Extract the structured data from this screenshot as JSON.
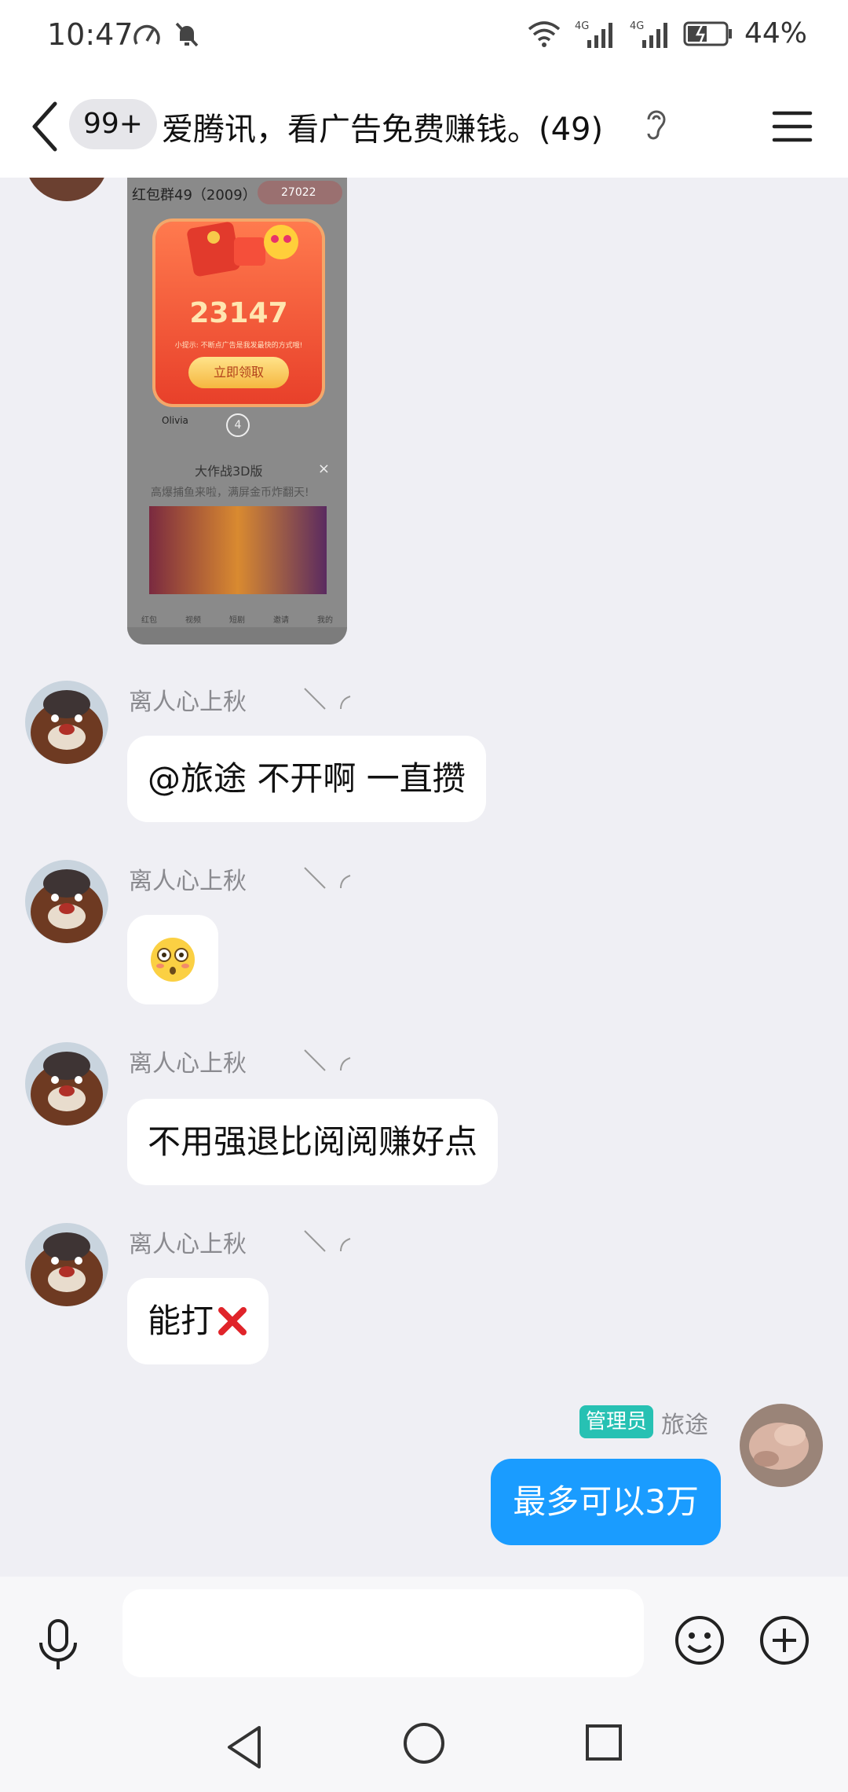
{
  "status_bar": {
    "time": "10:47",
    "battery_percent": "44%",
    "network_1": "4G",
    "network_2": "4G"
  },
  "header": {
    "unread_count": "99+",
    "title": "爱腾讯，看广告免费赚钱。(49)"
  },
  "image_message": {
    "group_title": "红包群49（2009）",
    "pill_count": "27022",
    "amount": "23147",
    "tip": "小提示: 不断点广告是我发最快的方式哦!",
    "claim_button": "立即领取",
    "count_badge": "4",
    "member_name": "Olivia",
    "ad_title": "大作战3D版",
    "ad_desc": "高爆捕鱼来啦，满屏金币炸翻天!",
    "nav_items": [
      "红包",
      "视频",
      "短剧",
      "邀请",
      "我的"
    ]
  },
  "messages": [
    {
      "sender": "离人心上秋",
      "text": "@旅途 不开啊 一直攒",
      "type": "text"
    },
    {
      "sender": "离人心上秋",
      "text": "",
      "type": "emoji",
      "emoji": "flushed-face"
    },
    {
      "sender": "离人心上秋",
      "text": "不用强退比阅阅赚好点",
      "type": "text"
    },
    {
      "sender": "离人心上秋",
      "text": "能打",
      "type": "text",
      "emoji": "cross-mark"
    }
  ],
  "self_message": {
    "badge": "管理员",
    "sender": "旅途",
    "text": "最多可以3万"
  },
  "input": {
    "value": "",
    "placeholder": ""
  },
  "colors": {
    "self_bubble": "#1a9cff",
    "admin_badge": "#27c1b3",
    "background": "#efeff4"
  }
}
